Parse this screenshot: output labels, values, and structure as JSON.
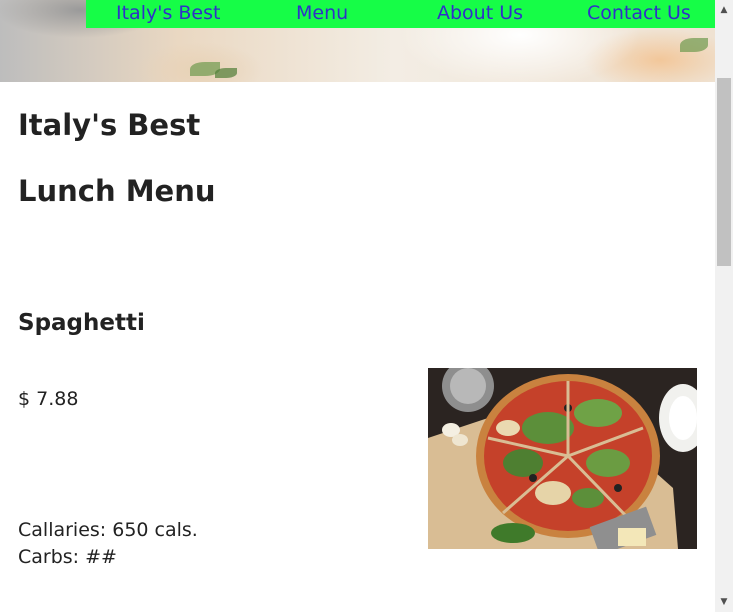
{
  "nav": {
    "items": [
      {
        "label": "Italy's Best"
      },
      {
        "label": "Menu"
      },
      {
        "label": "About Us"
      },
      {
        "label": "Contact Us"
      }
    ],
    "background_color": "#16fd47",
    "link_color": "#3030c8"
  },
  "main": {
    "site_title": "Italy's Best",
    "menu_title": "Lunch Menu",
    "item": {
      "name": "Spaghetti",
      "price": "$ 7.88",
      "calories": "Callaries: 650 cals.",
      "carbs": "Carbs: ##"
    }
  }
}
